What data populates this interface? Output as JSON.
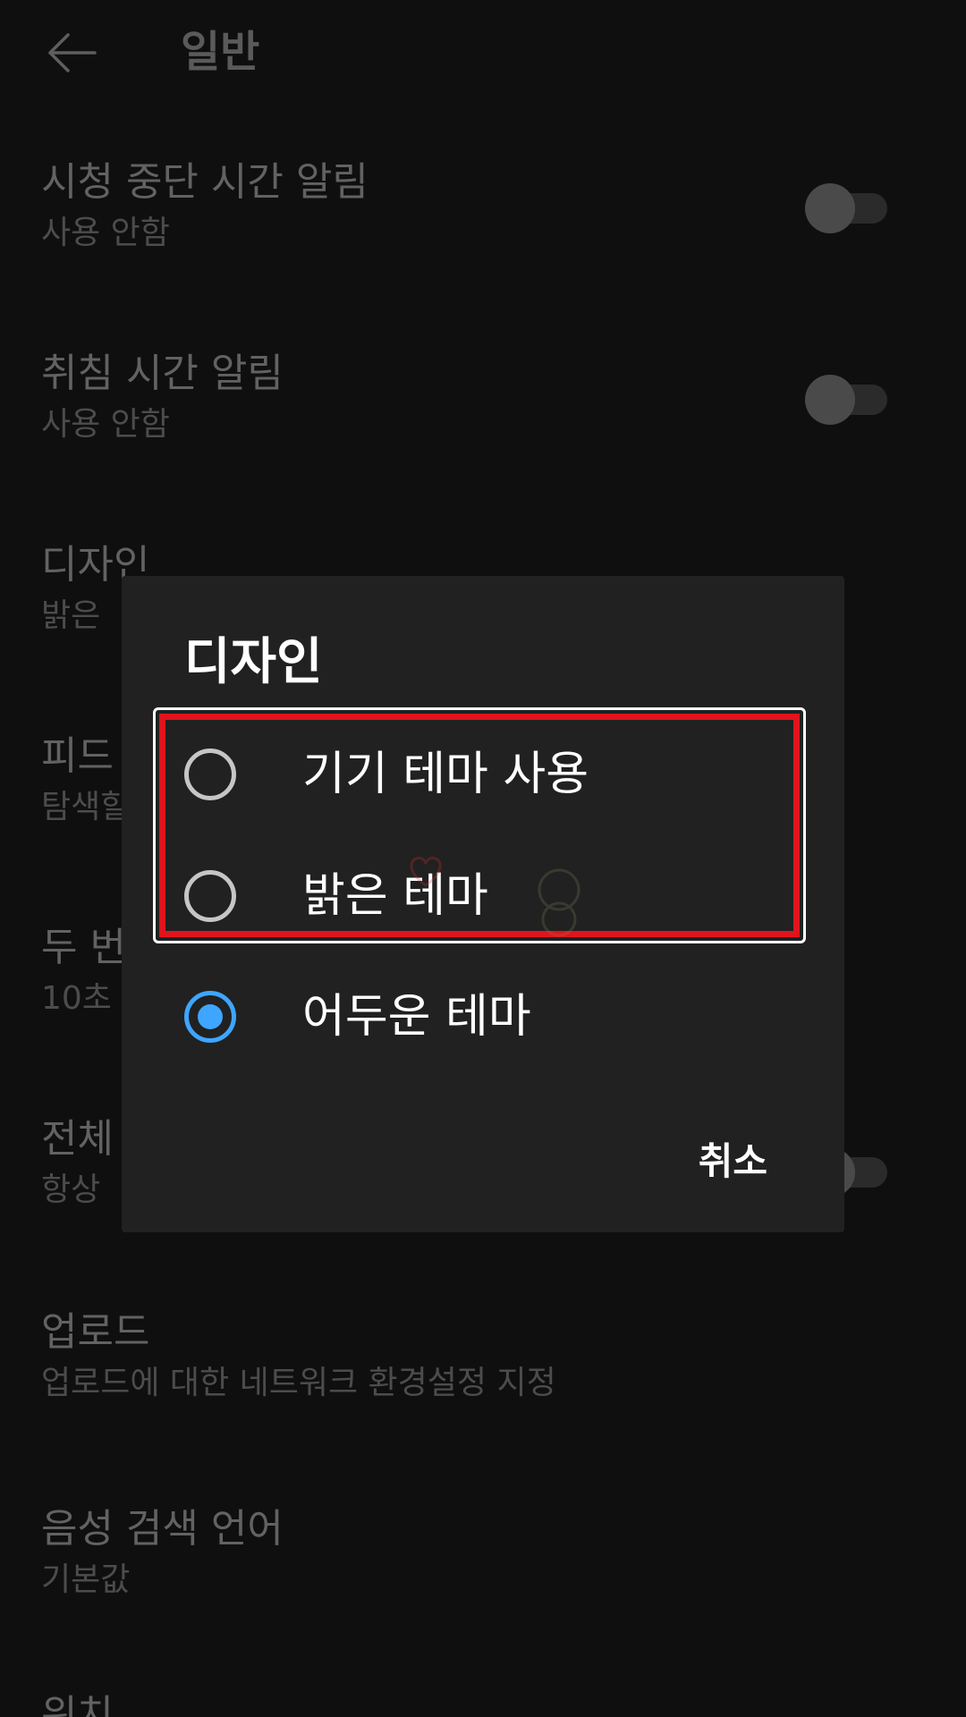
{
  "header": {
    "title": "일반",
    "back_icon": "arrow-left-icon"
  },
  "settings": [
    {
      "title": "시청 중단 시간 알림",
      "subtitle": "사용 안함",
      "toggle": false
    },
    {
      "title": "취침 시간 알림",
      "subtitle": "사용 안함",
      "toggle": false
    },
    {
      "title": "디자인",
      "subtitle": "밝은 "
    },
    {
      "title": "피드",
      "subtitle": "탐색할"
    },
    {
      "title": "두 번",
      "subtitle": "10초"
    },
    {
      "title": "전체",
      "subtitle": "항상 ",
      "toggle": false
    },
    {
      "title": "업로드",
      "subtitle": "업로드에 대한 네트워크 환경설정 지정"
    },
    {
      "title": "음성 검색 언어",
      "subtitle": "기본값"
    },
    {
      "title": "위치",
      "subtitle": ""
    }
  ],
  "dialog": {
    "title": "디자인",
    "options": [
      {
        "label": "기기 테마 사용",
        "selected": false
      },
      {
        "label": "밝은 테마",
        "selected": false
      },
      {
        "label": "어두운 테마",
        "selected": true
      }
    ],
    "cancel_label": "취소",
    "accent_color": "#3ea6ff",
    "highlight_color": "#e0141d"
  }
}
